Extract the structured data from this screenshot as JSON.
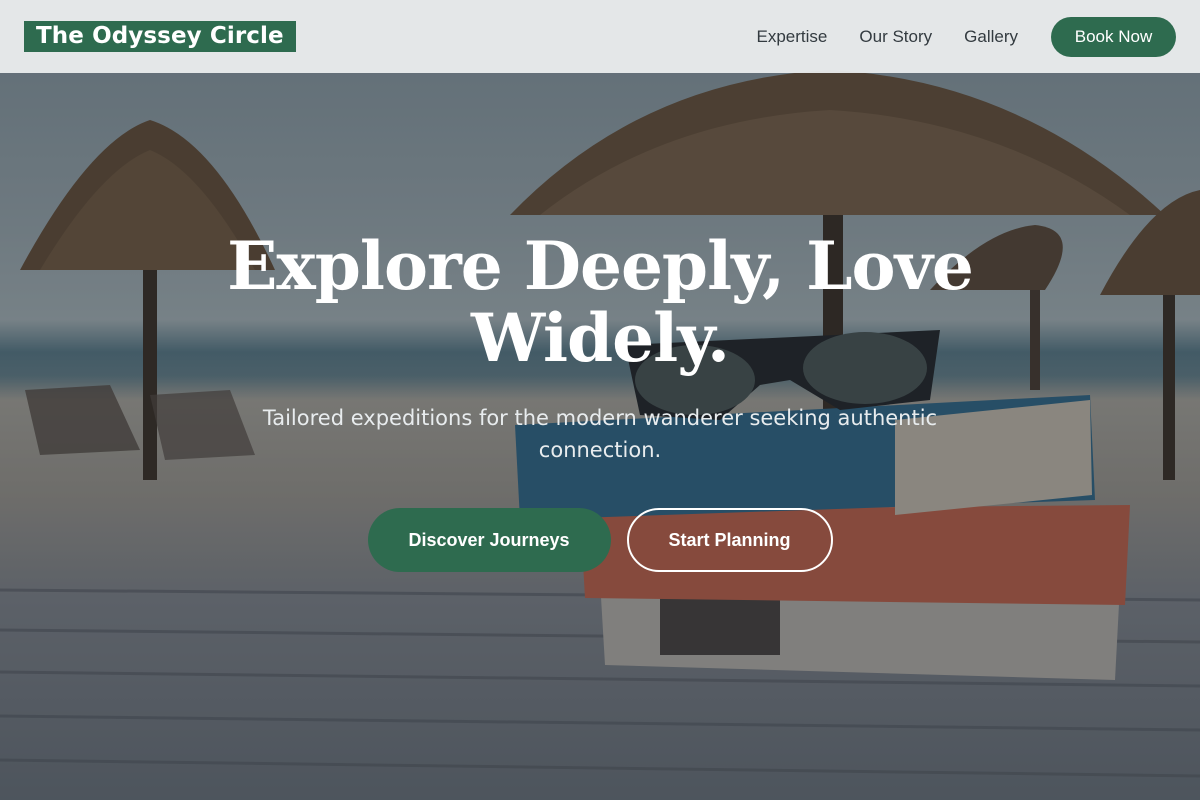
{
  "header": {
    "logo": "The Odyssey Circle",
    "nav": [
      "Expertise",
      "Our Story",
      "Gallery"
    ],
    "cta": "Book Now"
  },
  "hero": {
    "headline": "Explore Deeply, Love Widely.",
    "subtitle": "Tailored expeditions for the modern wanderer seeking authentic connection.",
    "primary_cta": "Discover Journeys",
    "secondary_cta": "Start Planning",
    "background": "beach-books-sunglasses-photo"
  },
  "colors": {
    "brand_green": "#2e6b4f",
    "header_bg": "#eef0f1",
    "text_dark": "#333b40",
    "white": "#ffffff"
  }
}
